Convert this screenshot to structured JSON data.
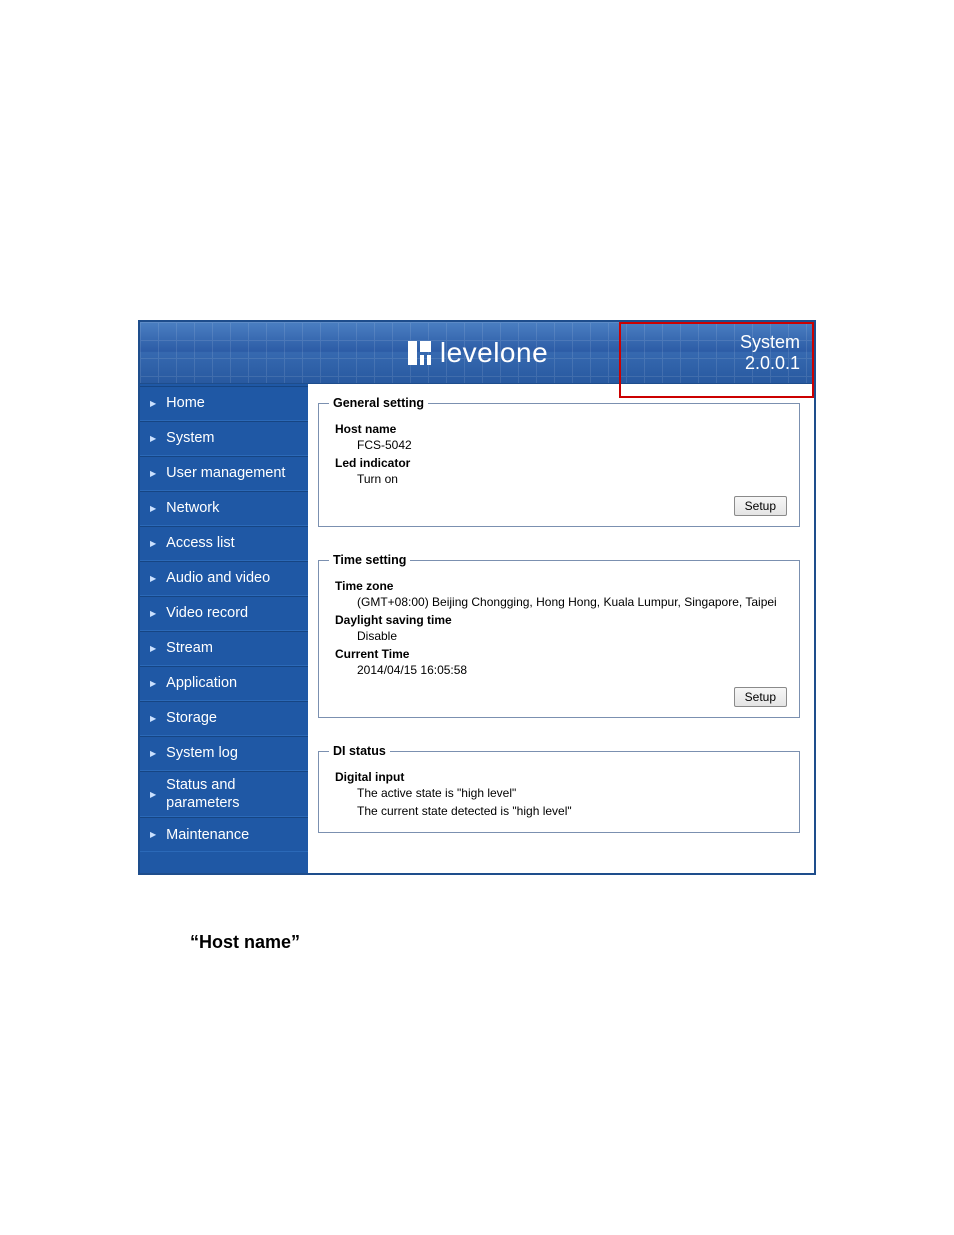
{
  "header": {
    "brand": "levelone",
    "version_label": "System",
    "version_number": "2.0.0.1"
  },
  "sidebar": {
    "items": [
      {
        "label": "Home"
      },
      {
        "label": "System"
      },
      {
        "label": "User management"
      },
      {
        "label": "Network"
      },
      {
        "label": "Access list"
      },
      {
        "label": "Audio and video"
      },
      {
        "label": "Video record"
      },
      {
        "label": "Stream"
      },
      {
        "label": "Application"
      },
      {
        "label": "Storage"
      },
      {
        "label": "System log"
      },
      {
        "label": "Status and parameters"
      },
      {
        "label": "Maintenance"
      }
    ]
  },
  "panels": {
    "general": {
      "legend": "General setting",
      "host_name_label": "Host name",
      "host_name_value": "FCS-5042",
      "led_label": "Led indicator",
      "led_value": "Turn on",
      "setup_btn": "Setup"
    },
    "time": {
      "legend": "Time setting",
      "tz_label": "Time zone",
      "tz_value": "(GMT+08:00) Beijing Chongging, Hong Hong, Kuala Lumpur, Singapore, Taipei",
      "dst_label": "Daylight saving time",
      "dst_value": "Disable",
      "current_label": "Current Time",
      "current_value": "2014/04/15 16:05:58",
      "setup_btn": "Setup"
    },
    "di": {
      "legend": "DI status",
      "di_label": "Digital input",
      "di_line1": "The active state is \"high level\"",
      "di_line2": "The current state detected is \"high level\""
    }
  },
  "caption": "“Host name”"
}
